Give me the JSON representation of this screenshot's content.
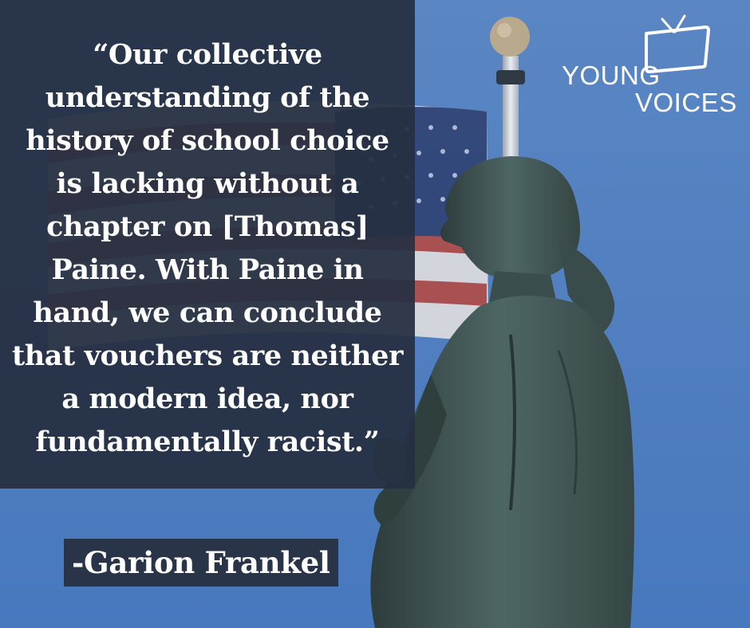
{
  "quote": {
    "text": "“Our collective\nunderstanding of the\nhistory of school choice\nis lacking without a\nchapter on [Thomas]\nPaine. With Paine in\nhand, we can conclude\nthat vouchers are neither\na modern idea, nor\nfundamentally racist.”"
  },
  "author": {
    "name": "-Garion Frankel"
  },
  "logo": {
    "line1": "YOUNG",
    "line2": "VOICES",
    "icon": "tv-icon"
  },
  "background": {
    "icons": [
      "american-flag-icon",
      "flagpole-icon",
      "statue-icon"
    ],
    "colors": {
      "sky": "#5a86c3",
      "panel": "#263042",
      "statue": "#3f5553",
      "flag_red": "#b8483f",
      "flag_blue": "#2e3f6e",
      "text": "#ffffff"
    }
  }
}
